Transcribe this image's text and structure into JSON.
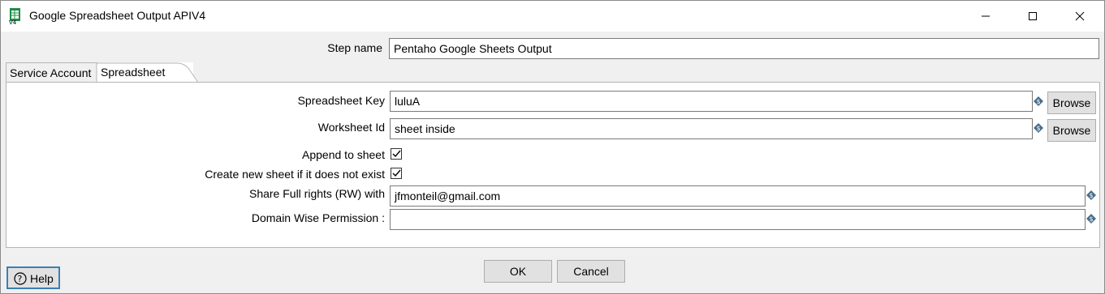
{
  "window": {
    "title": "Google Spreadsheet Output APIV4",
    "icon": "spreadsheet-icon"
  },
  "step": {
    "label": "Step name",
    "value": "Pentaho Google Sheets Output"
  },
  "tabs": [
    {
      "label": "Service Account",
      "active": false
    },
    {
      "label": "Spreadsheet",
      "active": true
    }
  ],
  "spreadsheet": {
    "key_label": "Spreadsheet Key",
    "key_value": "luluA",
    "worksheet_label": "Worksheet Id",
    "worksheet_value": "sheet inside",
    "browse_label": "Browse",
    "append_label": "Append to sheet",
    "append_checked": true,
    "create_label": "Create new sheet if it does not exist",
    "create_checked": true,
    "share_label": "Share Full rights (RW) with",
    "share_value": "jfmonteil@gmail.com",
    "domain_label": "Domain Wise Permission :",
    "domain_value": ""
  },
  "footer": {
    "ok_label": "OK",
    "cancel_label": "Cancel",
    "help_label": "Help"
  }
}
